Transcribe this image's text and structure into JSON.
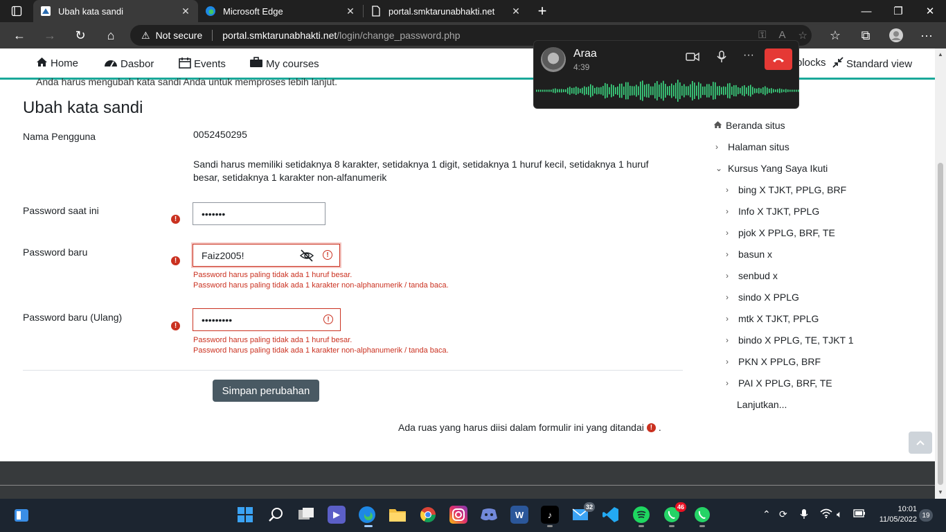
{
  "browser": {
    "tabs": [
      {
        "label": "Ubah kata sandi",
        "active": true,
        "icon": "moodle-icon"
      },
      {
        "label": "Microsoft Edge",
        "active": false,
        "icon": "edge-icon"
      },
      {
        "label": "portal.smktarunabhakti.net",
        "active": false,
        "icon": "page-icon"
      }
    ],
    "address": {
      "security": "Not secure",
      "host": "portal.smktarunabhakti.net",
      "path": "/login/change_password.php"
    }
  },
  "nav": {
    "home": "Home",
    "dashboard": "Dasbor",
    "events": "Events",
    "courses": "My courses",
    "blocks": "blocks",
    "standard_view": "Standard view"
  },
  "page": {
    "notice": "Anda harus mengubah kata sandi Anda untuk memproses lebih lanjut.",
    "title": "Ubah kata sandi",
    "username_label": "Nama Pengguna",
    "username_value": "0052450295",
    "rule": "Sandi harus memiliki setidaknya 8 karakter, setidaknya 1 digit, setidaknya 1 huruf kecil, setidaknya 1 huruf besar, setidaknya 1 karakter non-alfanumerik",
    "current_label": "Password saat ini",
    "current_value": "•••••••",
    "new_label": "Password baru",
    "new_value": "Faiz2005!",
    "new_errors": [
      "Password harus paling tidak ada 1 huruf besar.",
      "Password harus paling tidak ada 1 karakter non-alphanumerik / tanda baca."
    ],
    "repeat_label": "Password baru (Ulang)",
    "repeat_value": "•••••••••",
    "repeat_errors": [
      "Password harus paling tidak ada 1 huruf besar.",
      "Password harus paling tidak ada 1 karakter non-alphanumerik / tanda baca."
    ],
    "save_label": "Simpan perubahan",
    "required_note": "Ada ruas yang harus diisi dalam formulir ini yang ditandai",
    "required_note_end": "."
  },
  "sidebar": {
    "home": "Beranda situs",
    "pages": "Halaman situs",
    "my_courses": "Kursus Yang Saya Ikuti",
    "courses": [
      "bing X TJKT, PPLG, BRF",
      "Info X TJKT, PPLG",
      "pjok X PPLG, BRF, TE",
      "basun x",
      "senbud x",
      "sindo X PPLG",
      "mtk X TJKT, PPLG",
      "bindo X PPLG, TE, TJKT 1",
      "PKN X PPLG, BRF",
      "PAI X PPLG, BRF, TE"
    ],
    "more": "Lanjutkan..."
  },
  "call": {
    "name": "Araa",
    "duration": "4:39"
  },
  "taskbar": {
    "mail_badge": "32",
    "whatsapp_badge": "46",
    "time": "10:01",
    "date": "11/05/2022",
    "notifications": "19"
  },
  "colors": {
    "accent": "#1aa899",
    "error": "#ca3120",
    "button": "#495963"
  }
}
